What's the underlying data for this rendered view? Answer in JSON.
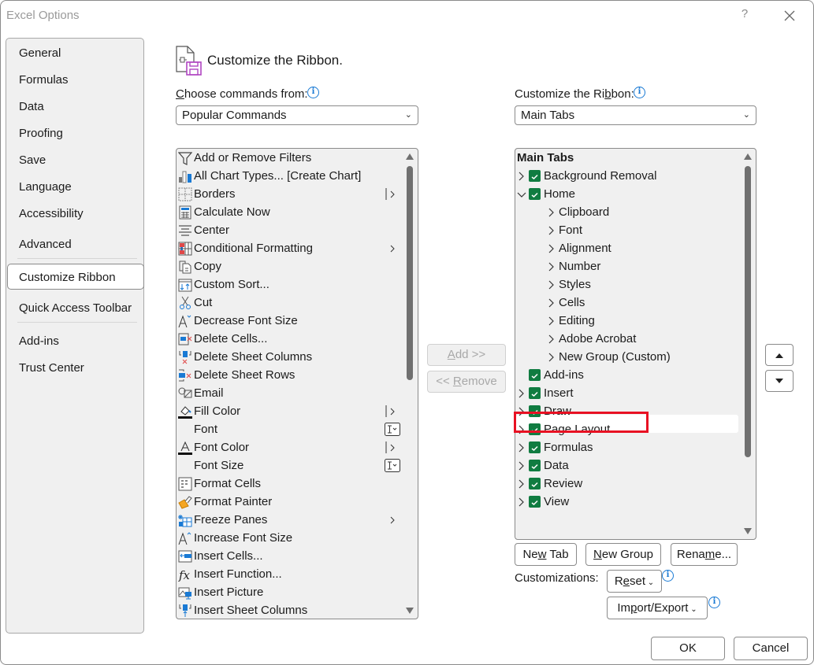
{
  "window": {
    "title": "Excel Options",
    "help_label": "?",
    "close_icon": "close-icon"
  },
  "sidebar": {
    "items": [
      {
        "label": "General"
      },
      {
        "label": "Formulas"
      },
      {
        "label": "Data"
      },
      {
        "label": "Proofing"
      },
      {
        "label": "Save"
      },
      {
        "label": "Language"
      },
      {
        "label": "Accessibility"
      },
      {
        "label": "Advanced"
      },
      {
        "label": "Customize Ribbon",
        "selected": true
      },
      {
        "label": "Quick Access Toolbar"
      },
      {
        "label": "Add-ins"
      },
      {
        "label": "Trust Center"
      }
    ]
  },
  "header": {
    "icon": "customize-ribbon-icon",
    "title": "Customize the Ribbon."
  },
  "left_panel": {
    "label_prefix": "C",
    "label_rest": "hoose commands from:",
    "combo_value": "Popular Commands",
    "commands": [
      {
        "label": "Add or Remove Filters",
        "icon": "filter-icon",
        "extra": ""
      },
      {
        "label": "All Chart Types... [Create Chart]",
        "icon": "chart-icon",
        "extra": ""
      },
      {
        "label": "Borders",
        "icon": "borders-icon",
        "extra": "split"
      },
      {
        "label": "Calculate Now",
        "icon": "calculator-icon",
        "extra": ""
      },
      {
        "label": "Center",
        "icon": "align-center-icon",
        "extra": ""
      },
      {
        "label": "Conditional Formatting",
        "icon": "conditional-formatting-icon",
        "extra": "submenu"
      },
      {
        "label": "Copy",
        "icon": "copy-icon",
        "extra": ""
      },
      {
        "label": "Custom Sort...",
        "icon": "sort-icon",
        "extra": ""
      },
      {
        "label": "Cut",
        "icon": "scissors-icon",
        "extra": ""
      },
      {
        "label": "Decrease Font Size",
        "icon": "decrease-font-icon",
        "extra": ""
      },
      {
        "label": "Delete Cells...",
        "icon": "delete-cells-icon",
        "extra": ""
      },
      {
        "label": "Delete Sheet Columns",
        "icon": "delete-columns-icon",
        "extra": ""
      },
      {
        "label": "Delete Sheet Rows",
        "icon": "delete-rows-icon",
        "extra": ""
      },
      {
        "label": "Email",
        "icon": "email-icon",
        "extra": ""
      },
      {
        "label": "Fill Color",
        "icon": "fill-color-icon",
        "extra": "split"
      },
      {
        "label": "Font",
        "icon": "",
        "extra": "combo"
      },
      {
        "label": "Font Color",
        "icon": "font-color-icon",
        "extra": "split"
      },
      {
        "label": "Font Size",
        "icon": "",
        "extra": "combo"
      },
      {
        "label": "Format Cells",
        "icon": "format-cells-icon",
        "extra": ""
      },
      {
        "label": "Format Painter",
        "icon": "format-painter-icon",
        "extra": ""
      },
      {
        "label": "Freeze Panes",
        "icon": "freeze-panes-icon",
        "extra": "submenu"
      },
      {
        "label": "Increase Font Size",
        "icon": "increase-font-icon",
        "extra": ""
      },
      {
        "label": "Insert Cells...",
        "icon": "insert-cells-icon",
        "extra": ""
      },
      {
        "label": "Insert Function...",
        "icon": "function-icon",
        "extra": ""
      },
      {
        "label": "Insert Picture",
        "icon": "picture-icon",
        "extra": ""
      },
      {
        "label": "Insert Sheet Columns",
        "icon": "insert-columns-icon",
        "extra": ""
      }
    ]
  },
  "middle": {
    "add_label_u": "A",
    "add_label_rest": "dd >>",
    "remove_label_pre": "<< ",
    "remove_label_u": "R",
    "remove_label_rest": "emove"
  },
  "right_panel": {
    "label_pre": "Customize the Ri",
    "label_u": "b",
    "label_rest": "bon:",
    "combo_value": "Main Tabs",
    "tree_header": "Main Tabs",
    "tree": [
      {
        "label": "Background Removal",
        "level": 0,
        "expander": "collapsed",
        "checked": true
      },
      {
        "label": "Home",
        "level": 0,
        "expander": "expanded",
        "checked": true
      },
      {
        "label": "Clipboard",
        "level": 1,
        "expander": "collapsed"
      },
      {
        "label": "Font",
        "level": 1,
        "expander": "collapsed"
      },
      {
        "label": "Alignment",
        "level": 1,
        "expander": "collapsed"
      },
      {
        "label": "Number",
        "level": 1,
        "expander": "collapsed"
      },
      {
        "label": "Styles",
        "level": 1,
        "expander": "collapsed"
      },
      {
        "label": "Cells",
        "level": 1,
        "expander": "collapsed"
      },
      {
        "label": "Editing",
        "level": 1,
        "expander": "collapsed"
      },
      {
        "label": "Adobe Acrobat",
        "level": 1,
        "expander": "collapsed"
      },
      {
        "label": "New Group (Custom)",
        "level": 1,
        "expander": "collapsed"
      },
      {
        "label": "Add-ins",
        "level": 0,
        "expander": "none",
        "checked": true
      },
      {
        "label": "Insert",
        "level": 0,
        "expander": "collapsed",
        "checked": true
      },
      {
        "label": "Draw",
        "level": 0,
        "expander": "collapsed",
        "checked": true,
        "selected": true
      },
      {
        "label": "Page Layout",
        "level": 0,
        "expander": "collapsed",
        "checked": true
      },
      {
        "label": "Formulas",
        "level": 0,
        "expander": "collapsed",
        "checked": true
      },
      {
        "label": "Data",
        "level": 0,
        "expander": "collapsed",
        "checked": true
      },
      {
        "label": "Review",
        "level": 0,
        "expander": "collapsed",
        "checked": true
      },
      {
        "label": "View",
        "level": 0,
        "expander": "collapsed",
        "checked": true
      }
    ],
    "new_tab": {
      "pre": "Ne",
      "u": "w",
      "rest": " Tab"
    },
    "new_group": {
      "pre": "",
      "u": "N",
      "rest": "ew Group"
    },
    "rename": {
      "pre": "Rena",
      "u": "m",
      "rest": "e..."
    },
    "customizations_label": "Customizations:",
    "reset": {
      "pre": "R",
      "u": "e",
      "rest": "set"
    },
    "import_export": {
      "pre": "Im",
      "u": "p",
      "rest": "ort/Export"
    },
    "move_up_icon": "move-up-icon",
    "move_down_icon": "move-down-icon"
  },
  "footer": {
    "ok_label": "OK",
    "cancel_label": "Cancel"
  },
  "colors": {
    "accent_check": "#107c41",
    "info_blue": "#1a7ad4",
    "highlight_red": "#e81123"
  }
}
